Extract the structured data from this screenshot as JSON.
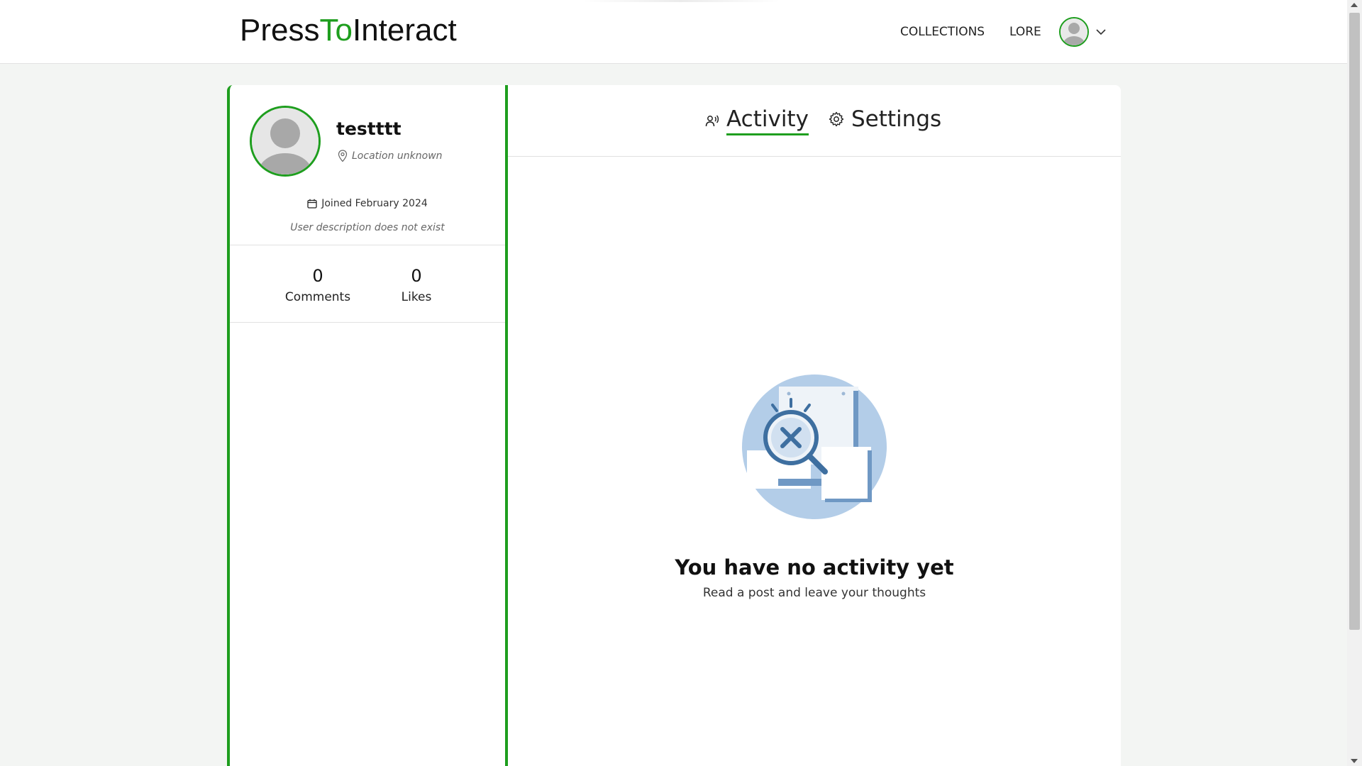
{
  "header": {
    "logo_part1": "Press",
    "logo_part2": "To",
    "logo_part3": "Interact",
    "nav": [
      "COLLECTIONS",
      "LORE"
    ],
    "avatar_icon": "user-avatar-icon",
    "menu_icon": "chevron-down-icon"
  },
  "profile": {
    "username": "testttt",
    "location": "Location unknown",
    "joined": "Joined February 2024",
    "description": "User description does not exist",
    "stats": [
      {
        "value": "0",
        "label": "Comments"
      },
      {
        "value": "0",
        "label": "Likes"
      }
    ]
  },
  "tabs": [
    {
      "label": "Activity",
      "icon": "people-voice-icon",
      "active": true
    },
    {
      "label": "Settings",
      "icon": "gear-icon",
      "active": false
    }
  ],
  "empty_state": {
    "title": "You have no activity yet",
    "subtitle": "Read a post and leave your thoughts",
    "illustration": "no-results-magnifier-icon"
  },
  "colors": {
    "accent": "#1e9e1e",
    "background": "#f3f5f3",
    "illustration_blue": "#b3cde8",
    "illustration_dark": "#3e6fa0"
  }
}
